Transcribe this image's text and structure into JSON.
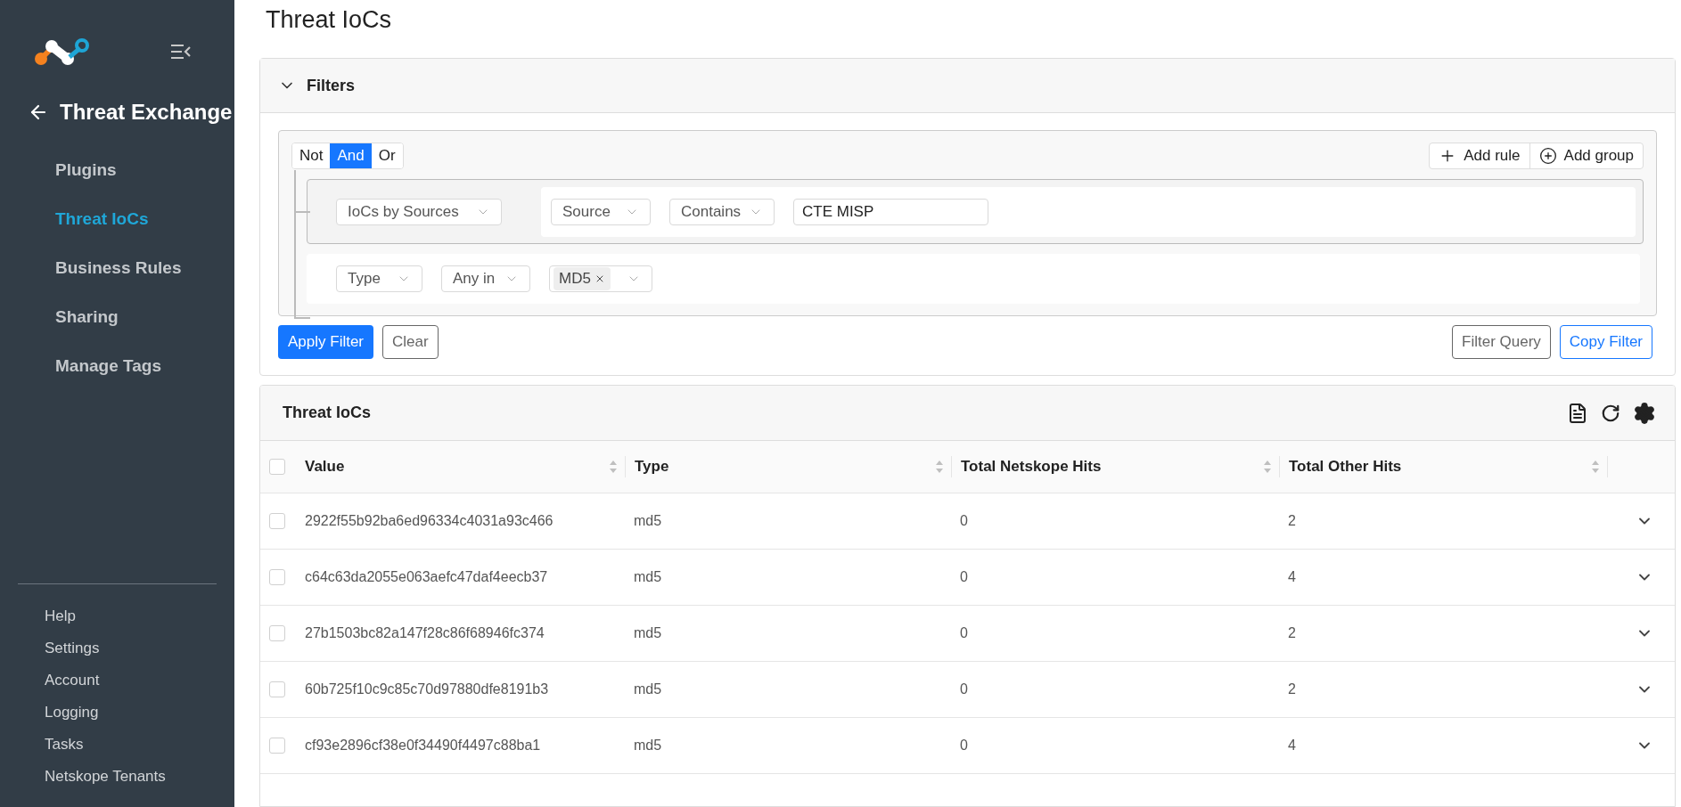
{
  "sidebar": {
    "back_title": "Threat Exchange",
    "items": [
      {
        "label": "Plugins",
        "selected": false
      },
      {
        "label": "Threat IoCs",
        "selected": true
      },
      {
        "label": "Business Rules",
        "selected": false
      },
      {
        "label": "Sharing",
        "selected": false
      },
      {
        "label": "Manage Tags",
        "selected": false
      }
    ],
    "bottom_links": [
      "Help",
      "Settings",
      "Account",
      "Logging",
      "Tasks",
      "Netskope Tenants"
    ]
  },
  "page_title": "Threat IoCs",
  "filters": {
    "title": "Filters",
    "expanded": true,
    "combinators": [
      {
        "label": "Not",
        "selected": false
      },
      {
        "label": "And",
        "selected": true
      },
      {
        "label": "Or",
        "selected": false
      }
    ],
    "actions": [
      "Add rule",
      "Add group"
    ],
    "rules": [
      {
        "kind": "group",
        "field": "IoCs by Sources",
        "subfield": "Source",
        "operator": "Contains",
        "value": "CTE MISP"
      },
      {
        "kind": "rule",
        "field": "Type",
        "operator": "Any in",
        "tags": [
          "MD5"
        ]
      }
    ],
    "apply": "Apply Filter",
    "clear": "Clear",
    "query": "Filter Query",
    "copy": "Copy Filter"
  },
  "table": {
    "title": "Threat IoCs",
    "select_all_checked": false,
    "columns": [
      "Value",
      "Type",
      "Total Netskope Hits",
      "Total Other Hits"
    ],
    "rows": [
      {
        "value": "2922f55b92ba6ed96334c4031a93c466",
        "type": "md5",
        "netskope_hits": "0",
        "other_hits": "2",
        "checked": false
      },
      {
        "value": "c64c63da2055e063aefc47daf4eecb37",
        "type": "md5",
        "netskope_hits": "0",
        "other_hits": "4",
        "checked": false
      },
      {
        "value": "27b1503bc82a147f28c86f68946fc374",
        "type": "md5",
        "netskope_hits": "0",
        "other_hits": "2",
        "checked": false
      },
      {
        "value": "60b725f10c9c85c70d97880dfe8191b3",
        "type": "md5",
        "netskope_hits": "0",
        "other_hits": "2",
        "checked": false
      },
      {
        "value": "cf93e2896cf38e0f34490f4497c88ba1",
        "type": "md5",
        "netskope_hits": "0",
        "other_hits": "4",
        "checked": false
      }
    ]
  }
}
